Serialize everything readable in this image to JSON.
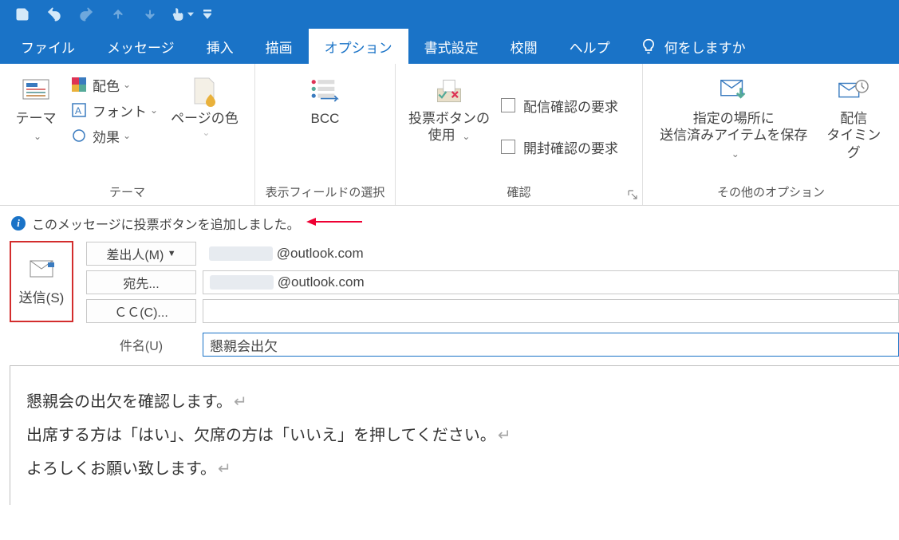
{
  "tabs": {
    "file": "ファイル",
    "message": "メッセージ",
    "insert": "挿入",
    "draw": "描画",
    "options": "オプション",
    "format": "書式設定",
    "review": "校閲",
    "help": "ヘルプ",
    "tellme": "何をしますか"
  },
  "ribbon": {
    "themes": {
      "theme_btn": "テーマ",
      "colors": "配色",
      "fonts": "フォント",
      "effects": "効果",
      "page_color": "ページの色",
      "group": "テーマ"
    },
    "fields": {
      "bcc": "BCC",
      "group": "表示フィールドの選択"
    },
    "tracking": {
      "voting": "投票ボタンの",
      "voting2": "使用",
      "request_delivery": "配信確認の要求",
      "request_read": "開封確認の要求",
      "group": "確認"
    },
    "more": {
      "save_sent1": "指定の場所に",
      "save_sent2": "送信済みアイテムを保存",
      "delay1": "配信",
      "delay2": "タイミング",
      "group": "その他のオプション"
    }
  },
  "info_bar": "このメッセージに投票ボタンを追加しました。",
  "compose": {
    "send": "送信(S)",
    "from_btn": "差出人(M)",
    "from_value": "@outlook.com",
    "to_btn": "宛先...",
    "to_value": "@outlook.com",
    "cc_btn": "ＣＣ(C)...",
    "subject_label": "件名(U)",
    "subject_value": "懇親会出欠"
  },
  "body": {
    "l1": "懇親会の出欠を確認します。",
    "l2": "出席する方は「はい」、欠席の方は「いいえ」を押してください。",
    "l3": "よろしくお願い致します。"
  }
}
